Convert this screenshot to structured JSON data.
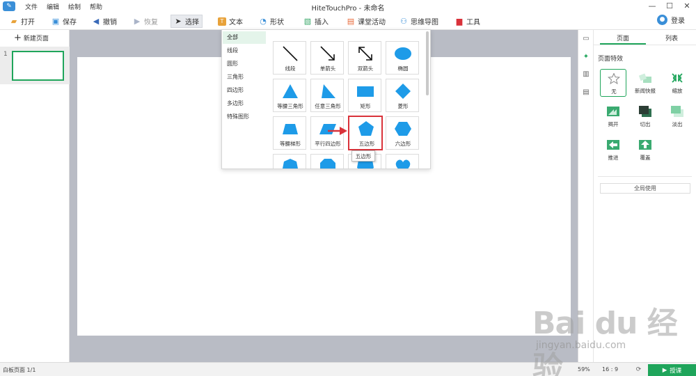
{
  "titlebar": {
    "title": "HiteTouchPro - 未命名",
    "menu": [
      "文件",
      "编辑",
      "绘制",
      "帮助"
    ],
    "logo_icon": "app-logo-icon"
  },
  "toolbar": {
    "open": "打开",
    "save": "保存",
    "undo": "撤销",
    "redo": "恢复",
    "select": "选择",
    "text": "文本",
    "shape": "形状",
    "insert": "插入",
    "class_activity": "课堂活动",
    "mindmap": "思维导图",
    "tools": "工具",
    "login": "登录"
  },
  "left_panel": {
    "new_page": "新建页面",
    "thumb_number": "1"
  },
  "shape_popup": {
    "categories": [
      "全部",
      "线段",
      "圆形",
      "三角形",
      "四边形",
      "多边形",
      "特殊图形"
    ],
    "selected_category": "全部",
    "shapes": [
      {
        "label": "线段",
        "icon": "line-shape-icon"
      },
      {
        "label": "单箭头",
        "icon": "single-arrow-shape-icon"
      },
      {
        "label": "双箭头",
        "icon": "double-arrow-shape-icon"
      },
      {
        "label": "椭圆",
        "icon": "ellipse-shape-icon"
      },
      {
        "label": "等腰三角形",
        "icon": "isosceles-triangle-shape-icon"
      },
      {
        "label": "任意三角形",
        "icon": "triangle-shape-icon"
      },
      {
        "label": "矩形",
        "icon": "rectangle-shape-icon"
      },
      {
        "label": "菱形",
        "icon": "diamond-shape-icon"
      },
      {
        "label": "等腰梯形",
        "icon": "trapezoid-shape-icon"
      },
      {
        "label": "平行四边形",
        "icon": "parallelogram-shape-icon"
      },
      {
        "label": "五边形",
        "icon": "pentagon-shape-icon"
      },
      {
        "label": "六边形",
        "icon": "hexagon-shape-icon"
      }
    ],
    "tooltip": "五边形",
    "shape_color": "#1e9be8",
    "highlight_color": "#d9323a"
  },
  "right_panel": {
    "tabs": [
      "页面",
      "列表"
    ],
    "active_tab": "页面",
    "section_title": "页面特效",
    "effects": [
      "无",
      "新闻快报",
      "缩放",
      "揭开",
      "切出",
      "淡出",
      "推进",
      "覆盖"
    ],
    "selected_effect": "无",
    "apply_all": "全局使用"
  },
  "statusbar": {
    "page_status": "白板页面 1/1",
    "zoom": "59%",
    "ratio": "16 : 9",
    "present": "授课"
  },
  "watermark": {
    "logo": "Bai  du 经验",
    "url": "jingyan.baidu.com"
  },
  "colors": {
    "accent": "#1fa55b",
    "canvas_bg": "#b9bcc5"
  }
}
